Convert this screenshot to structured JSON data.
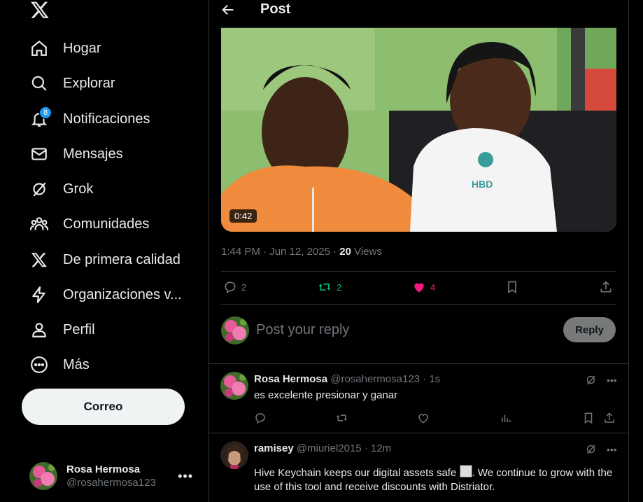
{
  "colors": {
    "background": "#000000",
    "accent": "#1d9bf0",
    "like": "#f91880",
    "repost": "#00ba7c",
    "muted": "#71767b"
  },
  "nav": {
    "items": [
      {
        "label": "Hogar",
        "icon": "home-icon"
      },
      {
        "label": "Explorar",
        "icon": "search-icon"
      },
      {
        "label": "Notificaciones",
        "icon": "bell-icon",
        "badge": "8"
      },
      {
        "label": "Mensajes",
        "icon": "mail-icon"
      },
      {
        "label": "Grok",
        "icon": "grok-icon"
      },
      {
        "label": "Comunidades",
        "icon": "communities-icon"
      },
      {
        "label": "De primera calidad",
        "icon": "x-logo-icon"
      },
      {
        "label": "Organizaciones v...",
        "icon": "lightning-icon"
      },
      {
        "label": "Perfil",
        "icon": "person-icon"
      },
      {
        "label": "Más",
        "icon": "more-circle-icon"
      }
    ],
    "post_button": "Correo"
  },
  "account": {
    "name": "Rosa Hermosa",
    "handle": "@rosahermosa123"
  },
  "header": {
    "title": "Post"
  },
  "post": {
    "video_duration": "0:42",
    "time": "1:44 PM · Jun 12, 2025 · ",
    "views_count": "20",
    "views_label": " Views",
    "replies": "2",
    "reposts": "2",
    "likes": "4"
  },
  "reply_box": {
    "placeholder": "Post your reply",
    "button": "Reply"
  },
  "replies": [
    {
      "name": "Rosa Hermosa",
      "handle": "@rosahermosa123 · 1s",
      "text": "es excelente presionar y ganar"
    },
    {
      "name": "ramisey",
      "handle": "@miuriel2015 · 12m",
      "text_before": "Hive Keychain keeps our digital assets safe ",
      "text_after": ". We continue to grow with the use of this tool and receive discounts with Distriator."
    }
  ]
}
